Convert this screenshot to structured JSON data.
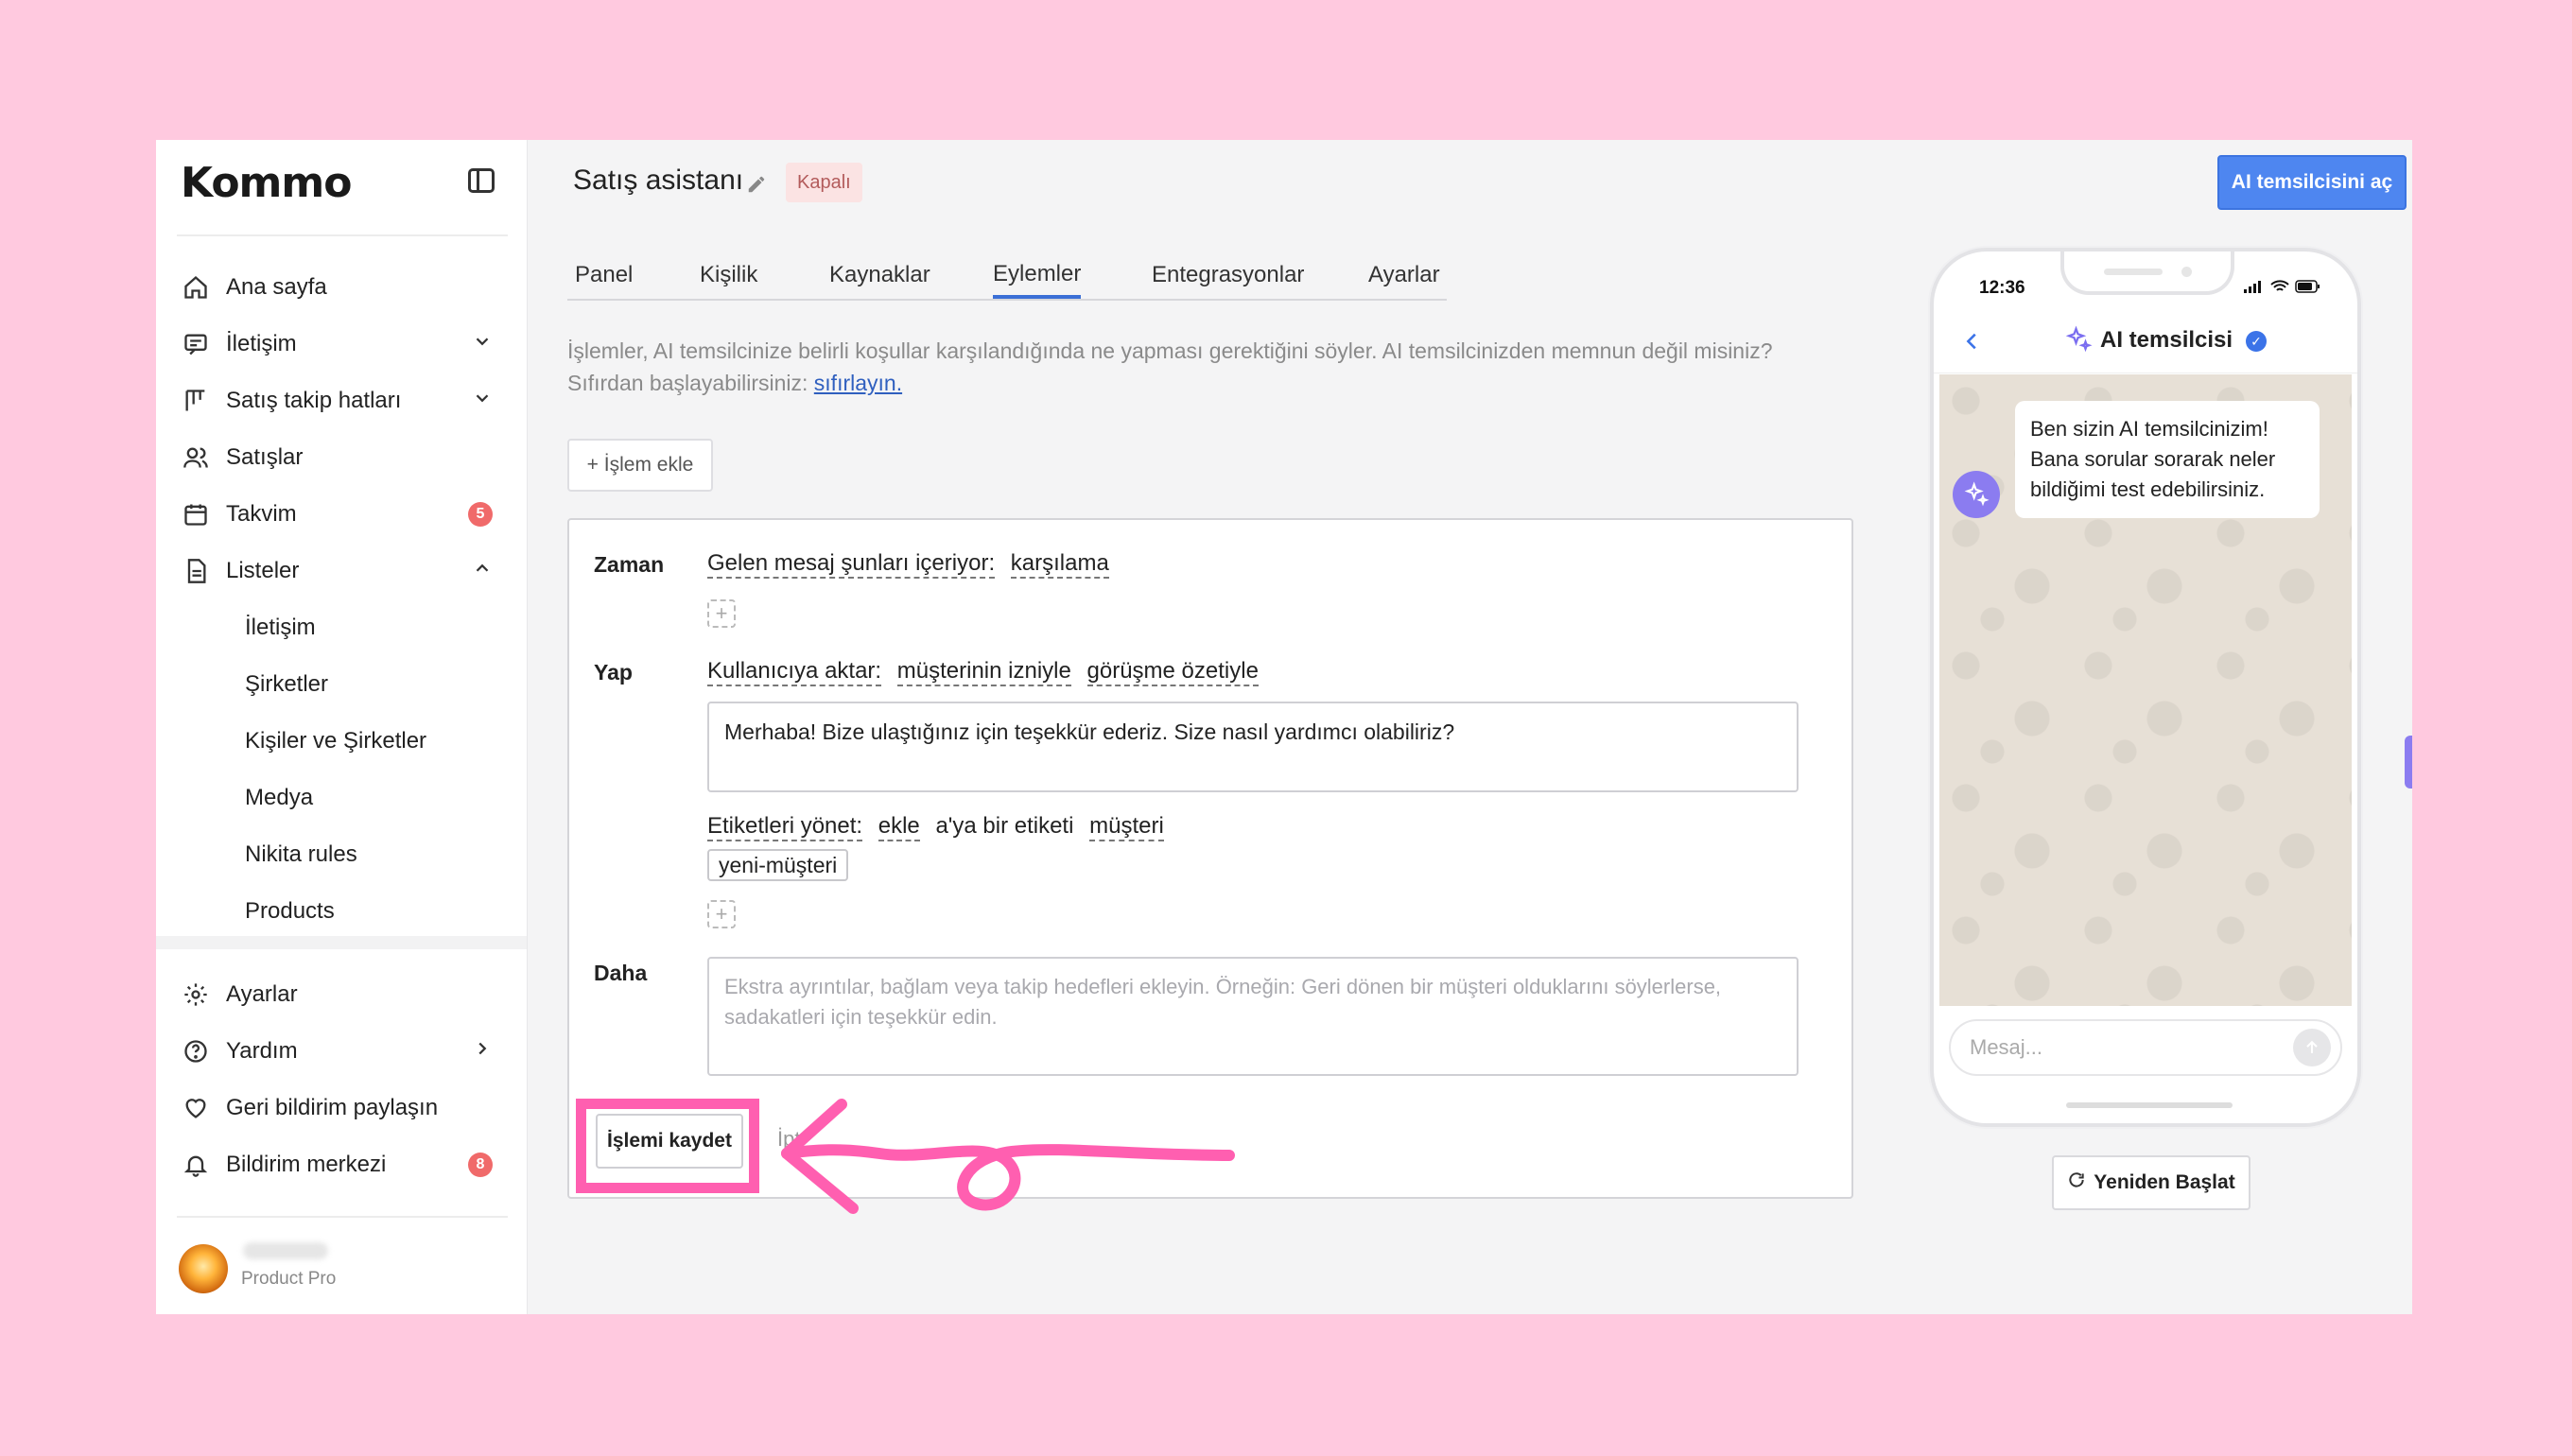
{
  "sidebar": {
    "logo": "Kommo",
    "items": [
      {
        "label": "Ana sayfa"
      },
      {
        "label": "İletişim"
      },
      {
        "label": "Satış takip hatları"
      },
      {
        "label": "Satışlar"
      },
      {
        "label": "Takvim",
        "badge": "5"
      },
      {
        "label": "Listeler"
      }
    ],
    "sub_items": [
      "İletişim",
      "Şirketler",
      "Kişiler ve Şirketler",
      "Medya",
      "Nikita rules",
      "Products"
    ],
    "bottom_items": [
      {
        "label": "Ayarlar"
      },
      {
        "label": "Yardım"
      },
      {
        "label": "Geri bildirim paylaşın"
      },
      {
        "label": "Bildirim merkezi",
        "badge": "8"
      }
    ],
    "user_plan": "Product Pro"
  },
  "header": {
    "title": "Satış asistanı",
    "status": "Kapalı",
    "open_agent_button": "AI temsilcisini aç"
  },
  "tabs": [
    "Panel",
    "Kişilik",
    "Kaynaklar",
    "Eylemler",
    "Entegrasyonlar",
    "Ayarlar"
  ],
  "active_tab": "Eylemler",
  "description": {
    "text": "İşlemler, AI temsilcinize belirli koşullar karşılandığında ne yapması gerektiğini söyler. AI temsilcinizden memnun değil misiniz? Sıfırdan başlayabilirsiniz: ",
    "link": "sıfırlayın."
  },
  "add_action_button": "+ İşlem ekle",
  "action": {
    "when_label": "Zaman",
    "when_trigger": "Gelen mesaj şunları içeriyor:",
    "when_value": "karşılama",
    "do_label": "Yap",
    "transfer_label": "Kullanıcıya aktar:",
    "transfer_opt1": "müşterinin izniyle",
    "transfer_opt2": "görüşme özetiyle",
    "message": "Merhaba! Bize ulaştığınız için teşekkür ederiz. Size nasıl yardımcı olabiliriz?",
    "tags_label": "Etiketleri yönet:",
    "tags_op": "ekle",
    "tags_mid": "a'ya bir etiketi",
    "tags_target": "müşteri",
    "tag_chip": "yeni-müşteri",
    "more_label": "Daha",
    "more_placeholder": "Ekstra ayrıntılar, bağlam veya takip hedefleri ekleyin. Örneğin: Geri dönen bir müşteri olduklarını söylerlerse, sadakatleri için teşekkür edin.",
    "save_button": "İşlemi kaydet",
    "cancel_button": "İptal"
  },
  "phone": {
    "time": "12:36",
    "title": "AI temsilcisi",
    "bot_message": "Ben sizin AI temsilcinizim! Bana sorular sorarak neler bildiğimi test edebilirsiniz.",
    "input_placeholder": "Mesaj...",
    "restart_button": "Yeniden Başlat"
  },
  "colors": {
    "background": "#ffc9df",
    "accent": "#4e86f0",
    "annotation": "#ff5fb0",
    "badge": "#f06a6a"
  }
}
